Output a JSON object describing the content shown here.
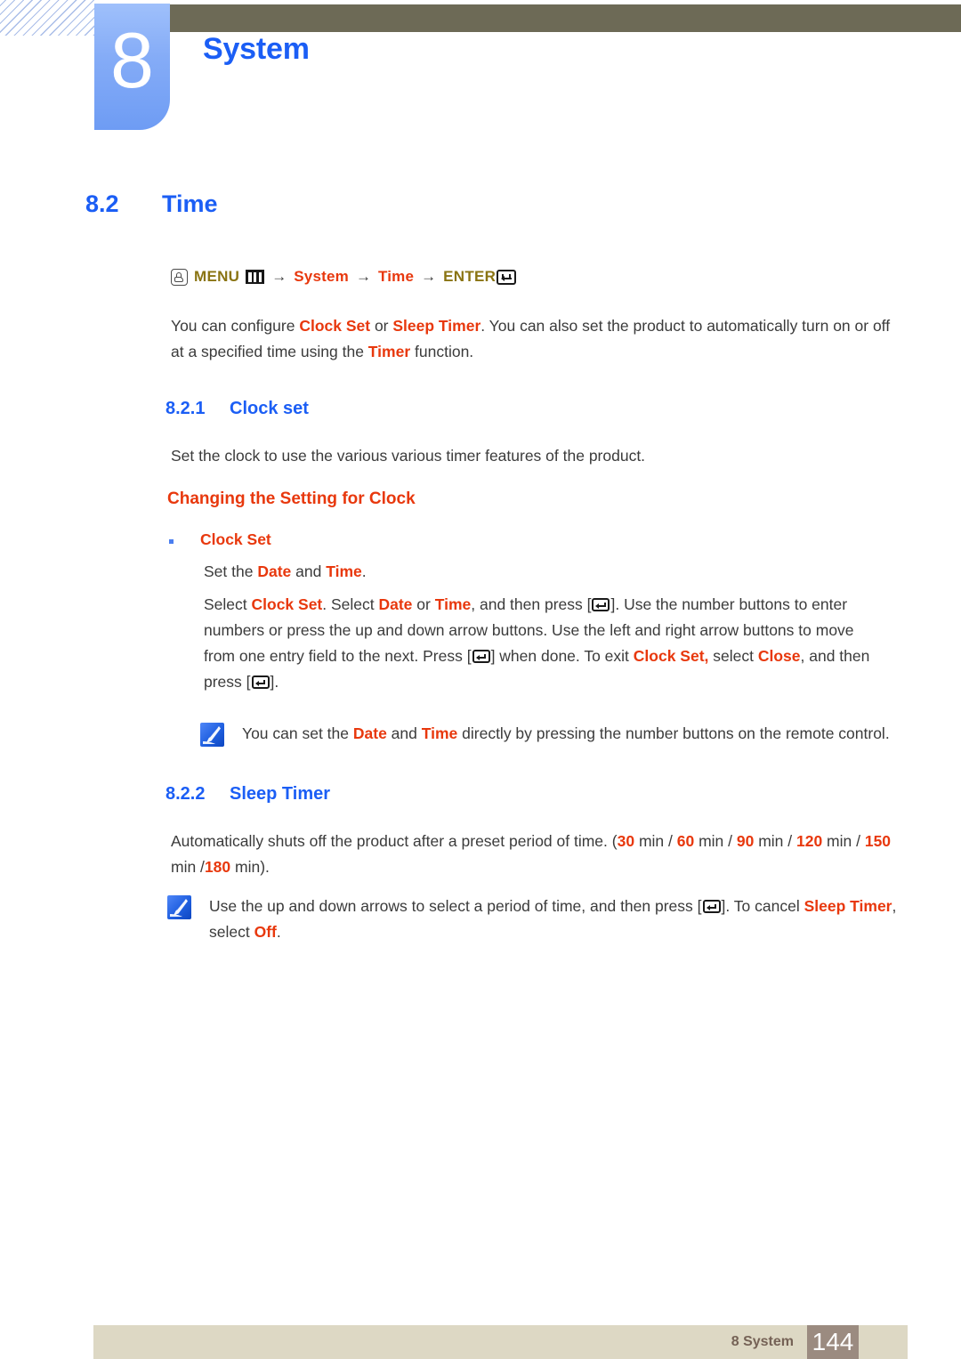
{
  "header": {
    "chapter_number": "8",
    "chapter_title": "System"
  },
  "section": {
    "number": "8.2",
    "title": "Time"
  },
  "menu_path": {
    "hand_icon": "hand-pointer-icon",
    "menu_label": "MENU",
    "menu_icon": "menu-bars-icon",
    "arrow1": "→",
    "item1": "System",
    "arrow2": "→",
    "item2": "Time",
    "arrow3": "→",
    "enter_label": "ENTER",
    "enter_icon": "enter-key-icon"
  },
  "intro": {
    "t1": "You can configure ",
    "hl1": "Clock Set",
    "t2": " or ",
    "hl2": "Sleep Timer",
    "t3": ". You can also set the product to automatically turn on or off at a specified time using the ",
    "hl3": "Timer",
    "t4": " function."
  },
  "clock_set": {
    "heading_number": "8.2.1",
    "heading_title": "Clock set",
    "description": "Set the clock to use the various various timer features of the product.",
    "subheading": "Changing the Setting for Clock",
    "bullet_label": "Clock Set",
    "line1": {
      "t1": "Set the ",
      "hl1": "Date",
      "t2": " and ",
      "hl2": "Time",
      "t3": "."
    },
    "line2": {
      "t1": "Select ",
      "hl1": "Clock Set",
      "t2": ". Select ",
      "hl2": "Date",
      "t3": " or ",
      "hl3": "Time",
      "t4": ", and then press [",
      "t5": "]. Use the number buttons to enter numbers or press the up and down arrow buttons. Use the left and right arrow buttons to move from one entry field to the next. Press [",
      "t6": "] when done. To exit ",
      "hl4": "Clock Set,",
      "t7": " select ",
      "hl5": "Close",
      "t8": ", and then press [",
      "t9": "]."
    },
    "note": {
      "icon": "note-pen-icon",
      "t1": "You can set the ",
      "hl1": "Date",
      "t2": " and ",
      "hl2": "Time",
      "t3": " directly by pressing the number buttons on the remote control."
    }
  },
  "sleep_timer": {
    "heading_number": "8.2.2",
    "heading_title": "Sleep Timer",
    "description": {
      "t1": "Automatically shuts off the product after a preset period of time. (",
      "hl1": "30",
      "t2": " min / ",
      "hl2": "60",
      "t3": " min / ",
      "hl3": "90",
      "t4": " min / ",
      "hl4": "120",
      "t5": " min / ",
      "hl5": "150",
      "t6": " min /",
      "hl6": "180",
      "t7": " min)."
    },
    "note": {
      "icon": "note-pen-icon",
      "t1": "Use the up and down arrows to select a period of time, and then press [",
      "t2": "]. To cancel ",
      "hl1": "Sleep Timer",
      "t3": ", select ",
      "hl2": "Off",
      "t4": "."
    }
  },
  "footer": {
    "label": "8 System",
    "page_number": "144"
  },
  "colors": {
    "accent_blue": "#1b5ef5",
    "highlight_orange": "#e8380d",
    "olive": "#8a7413",
    "header_bar": "#6d6a56",
    "footer_bar": "#ddd8c4",
    "footer_page_box": "#9b8b80"
  }
}
